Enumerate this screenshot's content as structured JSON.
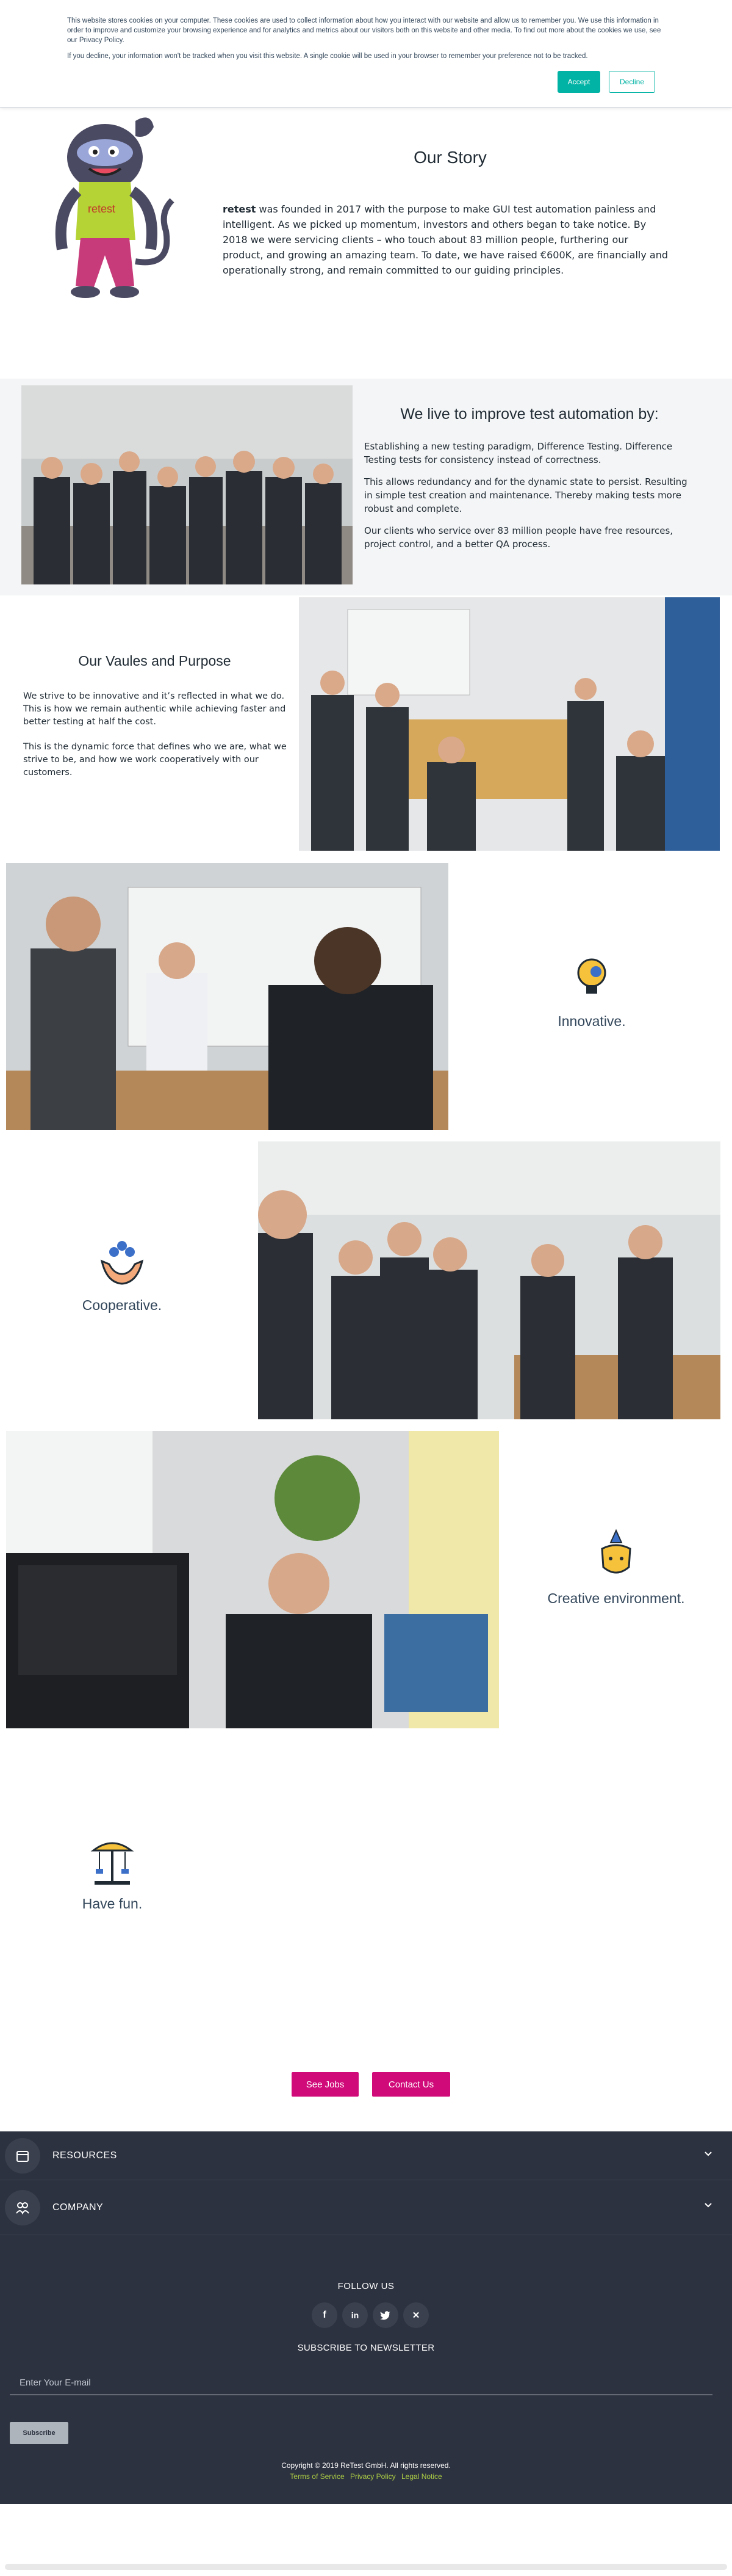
{
  "cookie": {
    "text1": "This website stores cookies on your computer. These cookies are used to collect information about how you interact with our website and allow us to remember you. We use this information in order to improve and customize your browsing experience and for analytics and metrics about our visitors both on this website and other media. To find out more about the cookies we use, see our Privacy Policy.",
    "text2": "If you decline, your information won't be tracked when you visit this website. A single cookie will be used in your browser to remember your preference not to be tracked.",
    "accept": "Accept",
    "decline": "Decline"
  },
  "story": {
    "title": "Our Story",
    "brand": "retest",
    "text": " was founded in 2017 with the purpose to make GUI test automation painless and intelligent. As we picked up momentum, investors and others began to take notice. By 2018 we were servicing clients – who touch about 83 million people, furthering our product, and growing an amazing team. To date, we have raised €600K, are financially and operationally strong, and remain committed to our guiding principles."
  },
  "improve": {
    "title": "We live to improve test automation by:",
    "p1": "Establishing a new testing paradigm, Difference Testing. Difference Testing tests for consistency instead of correctness.",
    "p2": "This allows redundancy and for the dynamic state to persist. Resulting in simple test creation and maintenance. Thereby making tests more robust and complete.",
    "p3": "Our clients who service over 83 million people have free resources, project control, and a better QA process."
  },
  "values": {
    "title": "Our Vaules and Purpose",
    "p1": "We strive to be innovative and it’s reflected in what we do. This is how we remain authentic while achieving faster and better testing at half the cost.",
    "p2": "This is the dynamic force that defines who we are, what we strive to be, and how we work cooperatively with our customers."
  },
  "features": {
    "innovative": "Innovative.",
    "cooperative": "Cooperative.",
    "creative": "Creative environment.",
    "fun": "Have fun."
  },
  "cta": {
    "jobs": "See Jobs",
    "contact": "Contact Us"
  },
  "footer": {
    "resources": "RESOURCES",
    "company": "COMPANY",
    "follow": "FOLLOW US",
    "subscribe_title": "SUBSCRIBE TO NEWSLETTER",
    "email_placeholder": "Enter Your E-mail",
    "subscribe_btn": "Subscribe",
    "copyright": "Copyright © 2019 ReTest GmbH. All rights reserved.",
    "terms": "Terms of Service",
    "privacy": "Privacy Policy",
    "legal": "Legal Notice",
    "social_icons": [
      "facebook-icon",
      "linkedin-icon",
      "twitter-icon",
      "xing-icon"
    ]
  },
  "colors": {
    "accent_teal": "#00b3a4",
    "cta_magenta": "#d10a7a",
    "footer_bg": "#2d3240",
    "link_green": "#aacc44"
  }
}
